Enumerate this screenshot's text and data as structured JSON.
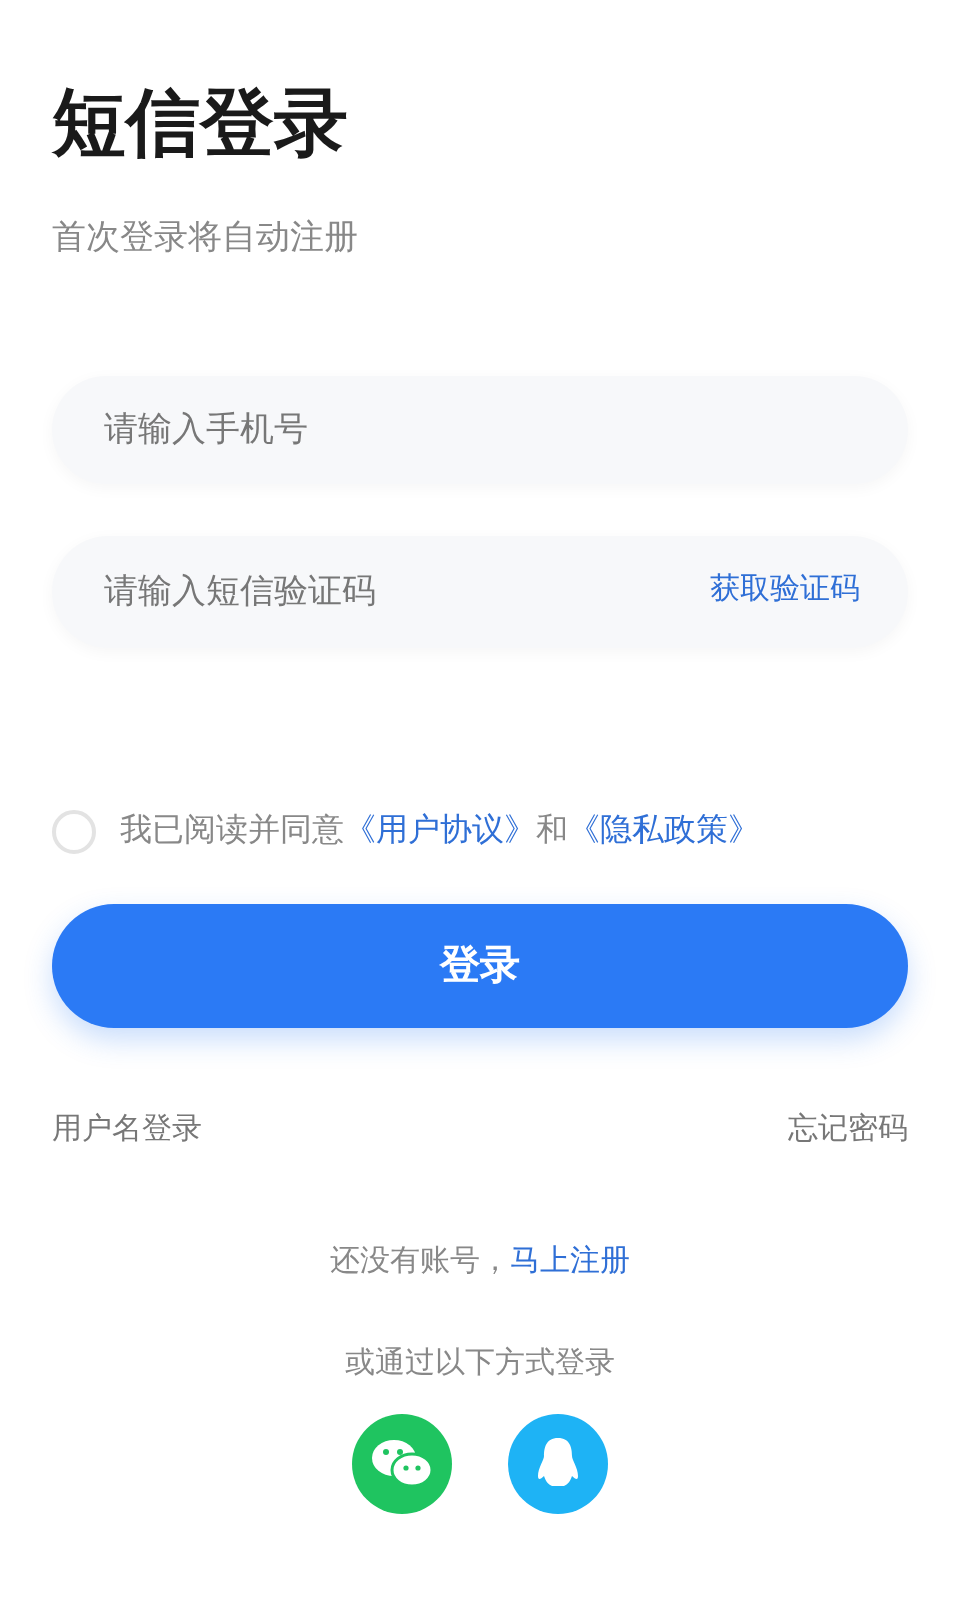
{
  "title": "短信登录",
  "subtitle": "首次登录将自动注册",
  "phone_field": {
    "placeholder": "请输入手机号"
  },
  "code_field": {
    "placeholder": "请输入短信验证码",
    "action": "获取验证码"
  },
  "agreement": {
    "checked": false,
    "parts": [
      {
        "kind": "text",
        "text": "我已阅读并同意"
      },
      {
        "kind": "link",
        "text": "《用户协议》"
      },
      {
        "kind": "text",
        "text": "和"
      },
      {
        "kind": "link",
        "text": "《隐私政策》"
      }
    ]
  },
  "login_button": "登录",
  "links": {
    "left": "用户名登录",
    "right": "忘记密码"
  },
  "signup": {
    "prompt": "还没有账号，",
    "link": "马上注册"
  },
  "other_login": {
    "label": "或通过以下方式登录",
    "methods": [
      {
        "kind": "wechat"
      },
      {
        "kind": "qq"
      }
    ]
  }
}
